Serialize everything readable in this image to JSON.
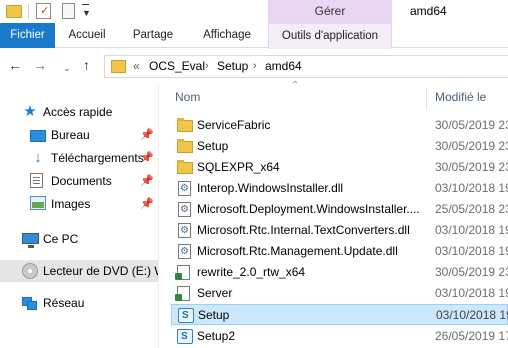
{
  "window": {
    "title": "amd64",
    "context_group": "Gérer"
  },
  "ribbon": {
    "tabs": [
      "Fichier",
      "Accueil",
      "Partage",
      "Affichage",
      "Outils d'application"
    ]
  },
  "address": {
    "overflow": "«",
    "breadcrumbs": [
      "OCS_Eval",
      "Setup",
      "amd64"
    ]
  },
  "sidebar": {
    "items": [
      {
        "label": "Accès rapide",
        "icon": "star-icon"
      },
      {
        "label": "Bureau",
        "icon": "desktop-icon",
        "pinned": true
      },
      {
        "label": "Téléchargements",
        "icon": "download-icon",
        "pinned": true
      },
      {
        "label": "Documents",
        "icon": "documents-icon",
        "pinned": true
      },
      {
        "label": "Images",
        "icon": "pictures-icon",
        "pinned": true
      },
      {
        "label": "Ce PC",
        "icon": "computer-icon"
      },
      {
        "label": "Lecteur de DVD (E:) W",
        "icon": "dvd-icon"
      },
      {
        "label": "Réseau",
        "icon": "network-icon"
      }
    ]
  },
  "columns": {
    "name": "Nom",
    "date": "Modifié le"
  },
  "files": [
    {
      "name": "ServiceFabric",
      "date": "30/05/2019 23",
      "type": "folder"
    },
    {
      "name": "Setup",
      "date": "30/05/2019 23",
      "type": "folder"
    },
    {
      "name": "SQLEXPR_x64",
      "date": "30/05/2019 23",
      "type": "folder"
    },
    {
      "name": "Interop.WindowsInstaller.dll",
      "date": "03/10/2018 19",
      "type": "dll"
    },
    {
      "name": "Microsoft.Deployment.WindowsInstaller....",
      "date": "25/05/2018 23",
      "type": "dll"
    },
    {
      "name": "Microsoft.Rtc.Internal.TextConverters.dll",
      "date": "03/10/2018 19",
      "type": "dll"
    },
    {
      "name": "Microsoft.Rtc.Management.Update.dll",
      "date": "03/10/2018 19",
      "type": "dll"
    },
    {
      "name": "rewrite_2.0_rtw_x64",
      "date": "30/05/2019 23",
      "type": "rewrite"
    },
    {
      "name": "Server",
      "date": "03/10/2018 19",
      "type": "server"
    },
    {
      "name": "Setup",
      "date": "03/10/2018 19",
      "type": "setup",
      "selected": true
    },
    {
      "name": "Setup2",
      "date": "26/05/2019 17",
      "type": "setup"
    }
  ]
}
